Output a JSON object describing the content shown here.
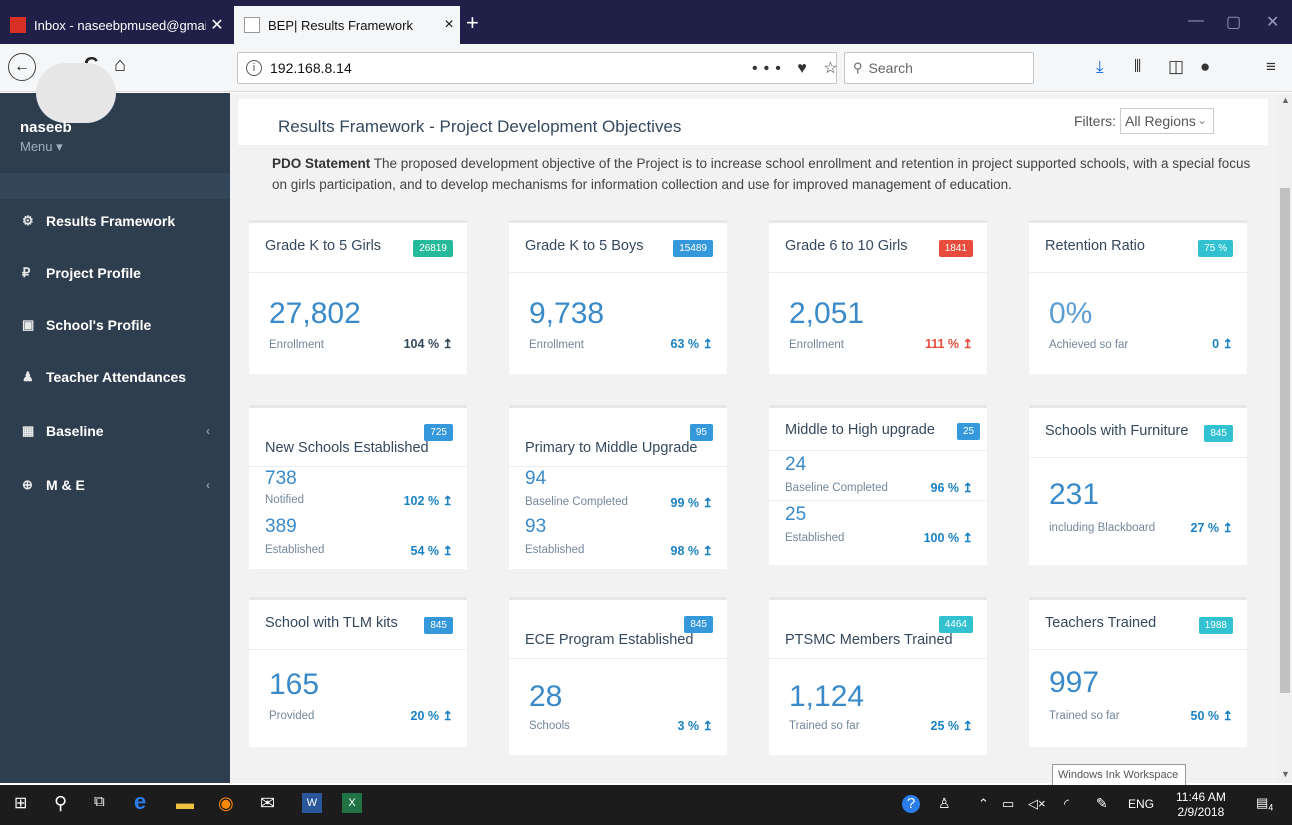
{
  "browser": {
    "tabs": [
      {
        "label": "Inbox - naseebpmused@gmail",
        "close": "✕"
      },
      {
        "label": "BEP| Results Framework",
        "close": "×"
      }
    ],
    "new_tab": "+",
    "window_controls": {
      "minimize": "—",
      "maximize": "▢",
      "close": "✕"
    },
    "url": "192.168.8.14",
    "url_info": "i",
    "url_actions": "••• ♥ ☆",
    "search_placeholder": "Search",
    "back": "←",
    "forward": "→",
    "reload": "C",
    "home": "⌂"
  },
  "sidebar": {
    "username": "naseeb",
    "menu": "Menu ▾",
    "items": [
      {
        "label": "Results Framework",
        "icon": "⚙",
        "chevron": ""
      },
      {
        "label": "Project Profile",
        "icon": "₽",
        "chevron": ""
      },
      {
        "label": "School's Profile",
        "icon": "▣",
        "chevron": ""
      },
      {
        "label": "Teacher Attendances",
        "icon": "♟",
        "chevron": ""
      },
      {
        "label": "Baseline",
        "icon": "▦",
        "chevron": "‹"
      },
      {
        "label": "M & E",
        "icon": "⊕",
        "chevron": "‹"
      }
    ]
  },
  "header": {
    "title": "Results Framework - Project Development Objectives",
    "filters_label": "Filters:",
    "filters_value": "All Regions",
    "pdo_label": "PDO Statement",
    "pdo_text": " The proposed development objective of the Project is to increase school enrollment and retention in project supported schools, with a special focus on girls participation, and to develop mechanisms for information collection and use for improved management of education."
  },
  "cards": {
    "k5_girls": {
      "title": "Grade K to 5 Girls",
      "badge": "26819",
      "value": "27,802",
      "label": "Enrollment",
      "pct": "104 % ↥"
    },
    "k5_boys": {
      "title": "Grade K to 5 Boys",
      "badge": "15489",
      "value": "9,738",
      "label": "Enrollment",
      "pct": "63 % ↥"
    },
    "g6_10_girls": {
      "title": "Grade 6 to 10 Girls",
      "badge": "1841",
      "value": "2,051",
      "label": "Enrollment",
      "pct": "111 % ↥"
    },
    "retention": {
      "title": "Retention Ratio",
      "badge": "75 %",
      "value": "0%",
      "label": "Achieved so far",
      "pct": "0 ↥"
    },
    "new_schools": {
      "title": "New Schools Established",
      "badge": "725",
      "rows": [
        {
          "value": "738",
          "label": "Notified",
          "pct": "102 % ↥"
        },
        {
          "value": "389",
          "label": "Established",
          "pct": "54 % ↥"
        }
      ]
    },
    "prim_middle": {
      "title": "Primary to Middle Upgrade",
      "badge": "95",
      "rows": [
        {
          "value": "94",
          "label": "Baseline Completed",
          "pct": "99 % ↥"
        },
        {
          "value": "93",
          "label": "Established",
          "pct": "98 % ↥"
        }
      ]
    },
    "middle_high": {
      "title": "Middle to High upgrade",
      "badge": "25",
      "rows": [
        {
          "value": "24",
          "label": "Baseline Completed",
          "pct": "96 % ↥"
        },
        {
          "value": "25",
          "label": "Established",
          "pct": "100 % ↥"
        }
      ]
    },
    "furniture": {
      "title": "Schools with Furniture",
      "badge": "845",
      "value": "231",
      "label": "including Blackboard",
      "pct": "27 % ↥"
    },
    "tlm": {
      "title": "School with TLM kits",
      "badge": "845",
      "value": "165",
      "label": "Provided",
      "pct": "20 % ↥"
    },
    "ece": {
      "title": "ECE Program Established",
      "badge": "845",
      "value": "28",
      "label": "Schools",
      "pct": "3 % ↥"
    },
    "ptsmc": {
      "title": "PTSMC Members Trained",
      "badge": "4464",
      "value": "1,124",
      "label": "Trained so far",
      "pct": "25 % ↥"
    },
    "teachers": {
      "title": "Teachers Trained",
      "badge": "1988",
      "value": "997",
      "label": "Trained so far",
      "pct": "50 % ↥"
    }
  },
  "tooltip": "Windows Ink Workspace",
  "taskbar": {
    "lang": "ENG",
    "time": "11:46 AM",
    "date": "2/9/2018",
    "notifications": "4"
  },
  "colors": {
    "sidebar": "#2f3e4e",
    "accent_blue": "#3a8ac9",
    "badge_green": "#26b99a",
    "badge_blue": "#3498db",
    "badge_red": "#e74c3c",
    "badge_teal": "#31c1d0"
  }
}
